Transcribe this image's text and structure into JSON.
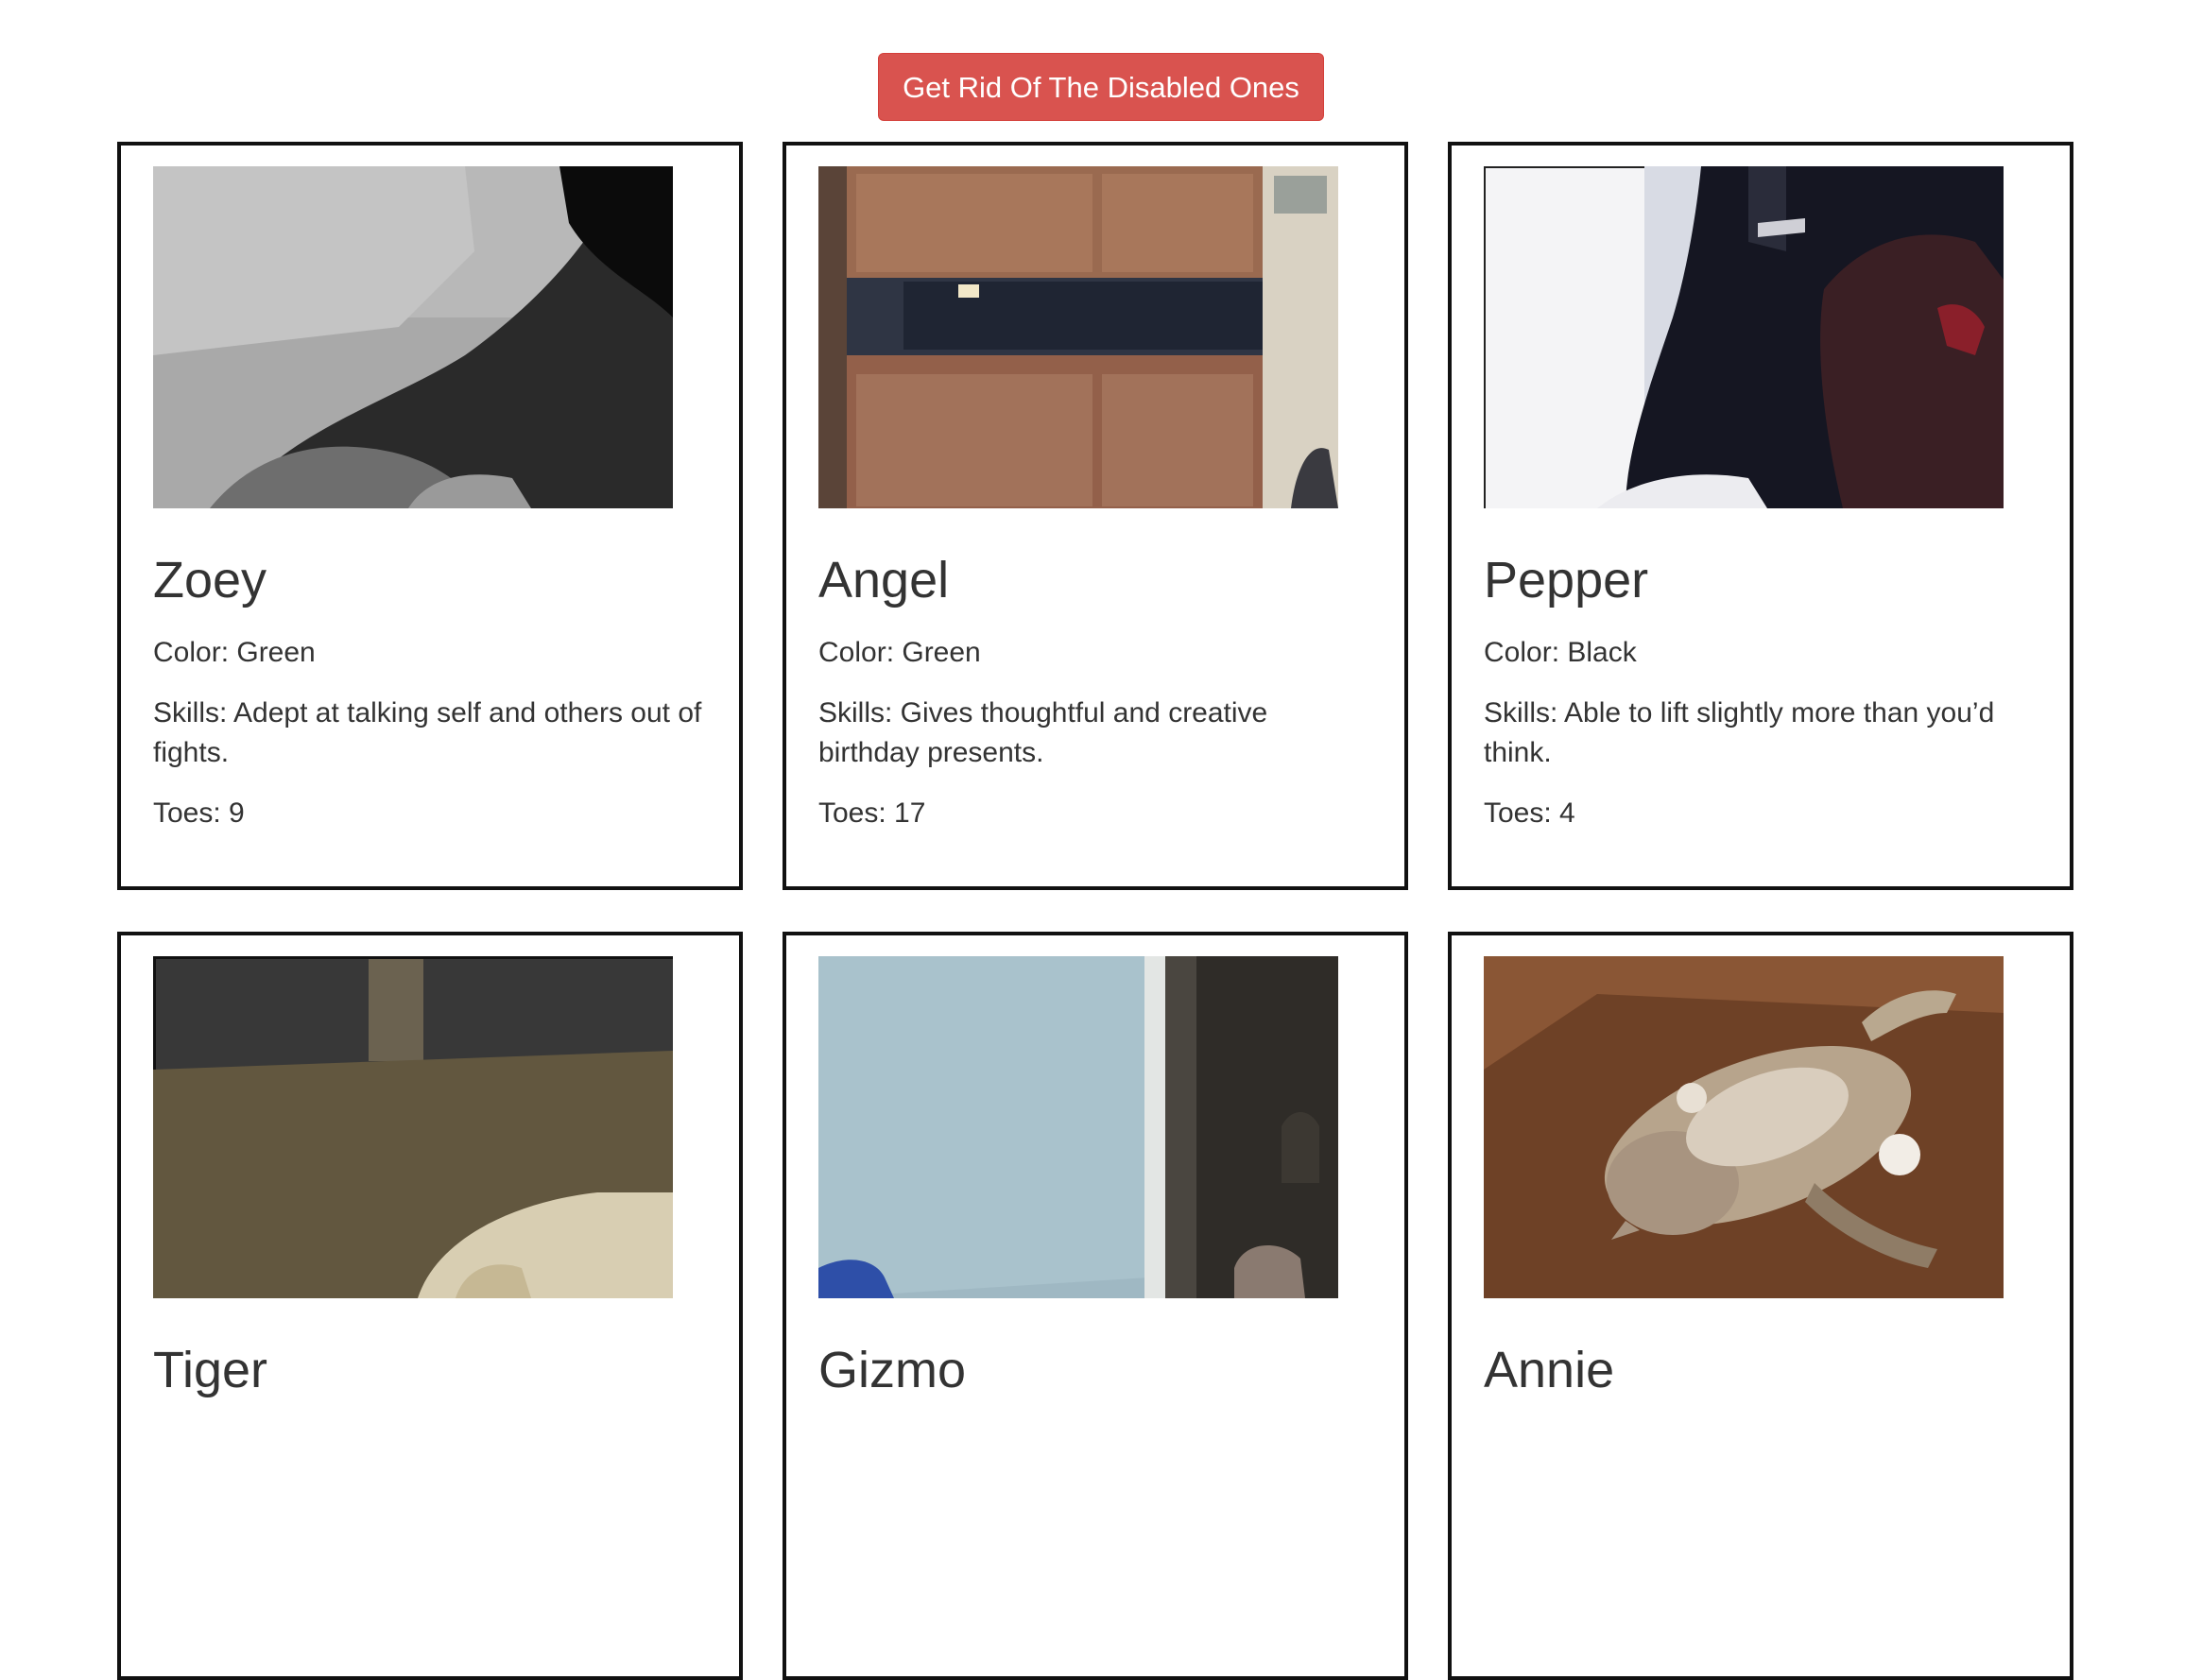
{
  "toolbar": {
    "remove_disabled_label": "Get Rid Of The Disabled Ones"
  },
  "colors": {
    "button": "#d9534f",
    "card_border": "#111111",
    "text": "#333333"
  },
  "cards": [
    {
      "name": "Zoey",
      "color": "Color: Green",
      "skills": "Skills: Adept at talking self and others out of fights.",
      "toes": "Toes: 9",
      "image": "cat-photo-gray-blur"
    },
    {
      "name": "Angel",
      "color": "Color: Green",
      "skills": "Skills: Gives thoughtful and creative birthday presents.",
      "toes": "Toes: 17",
      "image": "cat-photo-cabinet"
    },
    {
      "name": "Pepper",
      "color": "Color: Black",
      "skills": "Skills: Able to lift slightly more than you’d think.",
      "toes": "Toes: 4",
      "image": "cat-photo-black-blur"
    },
    {
      "name": "Tiger",
      "image": "cat-photo-dark-room"
    },
    {
      "name": "Gizmo",
      "image": "cat-photo-blue-wall"
    },
    {
      "name": "Annie",
      "image": "cat-photo-box"
    }
  ]
}
